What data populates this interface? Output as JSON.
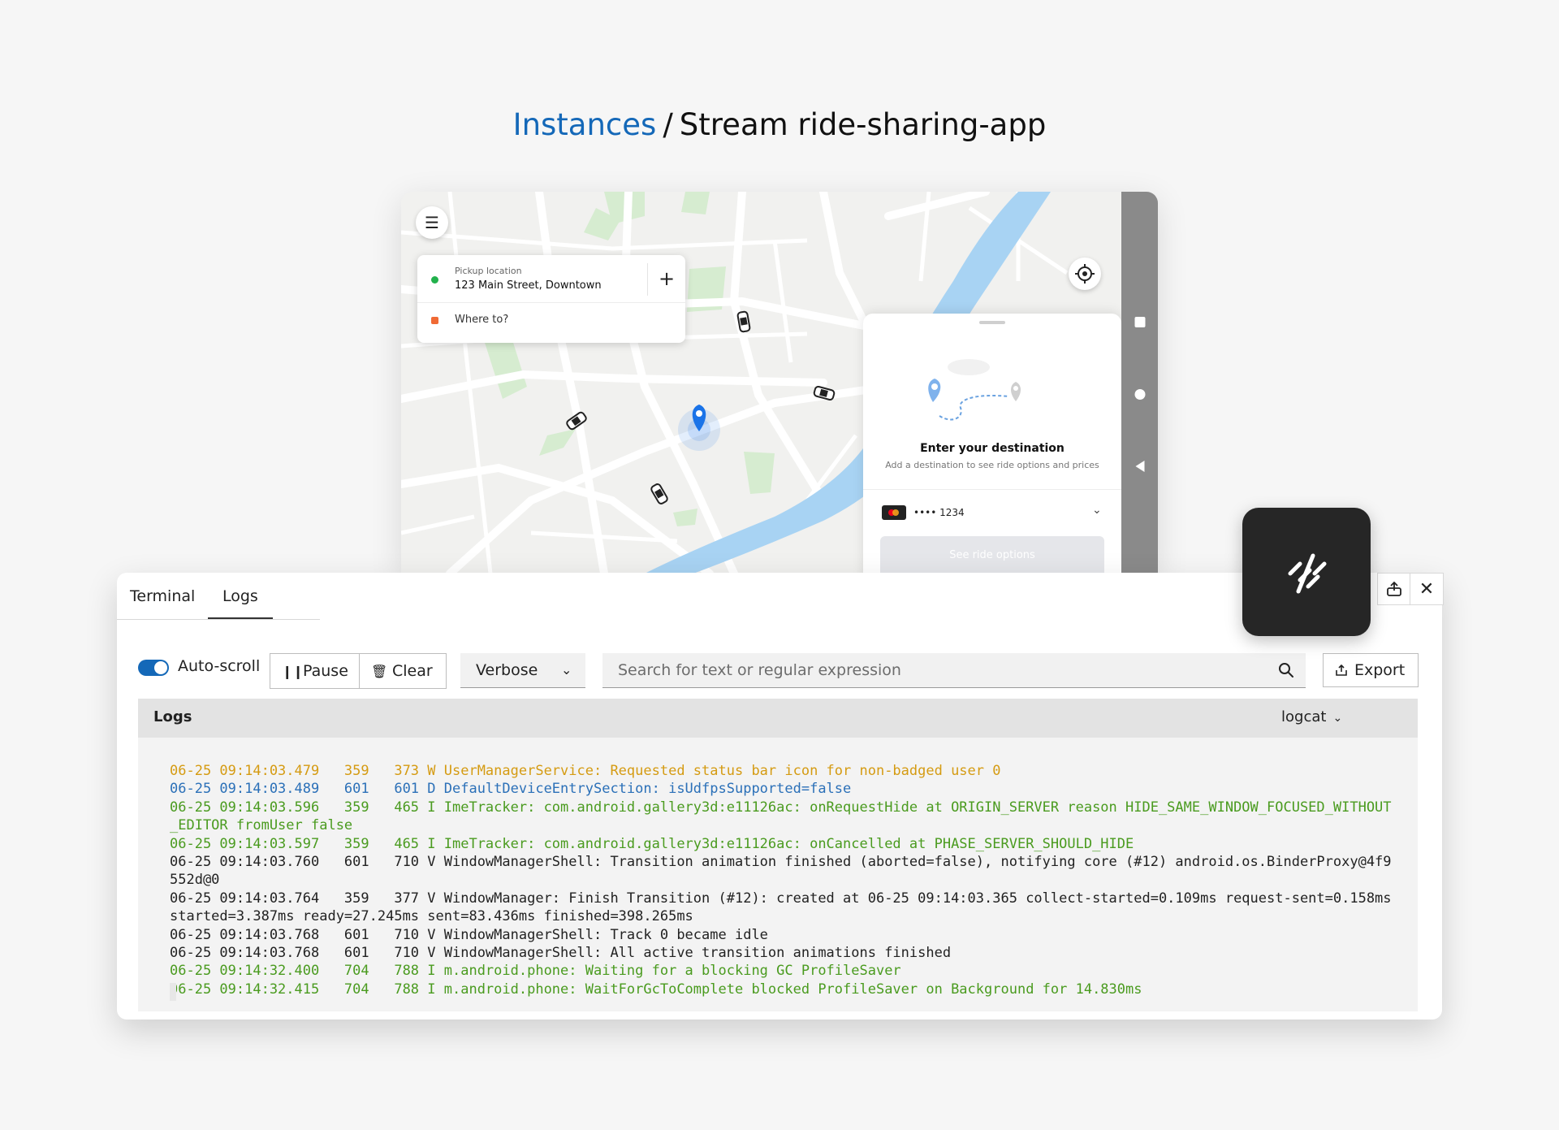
{
  "breadcrumb": {
    "link": "Instances",
    "separator": "/",
    "current": "Stream ride-sharing-app"
  },
  "app": {
    "pickup_label": "Pickup location",
    "pickup_value": "123 Main Street, Downtown",
    "destination_placeholder": "Where to?",
    "sheet_title": "Enter your destination",
    "sheet_subtitle": "Add a destination to see ride options and prices",
    "card_number": "•••• 1234",
    "see_options_label": "See ride options"
  },
  "panel": {
    "tabs": [
      {
        "label": "Terminal"
      },
      {
        "label": "Logs",
        "active": true
      }
    ],
    "autoscroll_label": "Auto-scroll",
    "autoscroll_on": true,
    "pause_label": "Pause",
    "clear_label": "Clear",
    "level_value": "Verbose",
    "search_placeholder": "Search for text or regular expression",
    "export_label": "Export",
    "logs_title": "Logs",
    "log_source": "logcat"
  },
  "colors": {
    "accent": "#1468b8",
    "log_W": "#d59b12",
    "log_D": "#2b70b8",
    "log_I": "#4a9b1f",
    "log_V": "#222222"
  },
  "icons": {
    "menu": "hamburger-icon",
    "add": "plus-icon",
    "locate": "crosshair-icon",
    "chevron": "chevron-down-icon",
    "pause": "pause-icon",
    "clear": "trash-icon",
    "search": "search-icon",
    "export": "share-icon",
    "dock": "dock-icon",
    "close": "close-icon",
    "stream": "stream-slash-icon"
  },
  "logs": [
    {
      "level": "W",
      "text": "06-25 09:14:03.479   359   373 W UserManagerService: Requested status bar icon for non-badged user 0"
    },
    {
      "level": "D",
      "text": "06-25 09:14:03.489   601   601 D DefaultDeviceEntrySection: isUdfpsSupported=false"
    },
    {
      "level": "I",
      "text": "06-25 09:14:03.596   359   465 I ImeTracker: com.android.gallery3d:e11126ac: onRequestHide at ORIGIN_SERVER reason HIDE_SAME_WINDOW_FOCUSED_WITHOUT_EDITOR fromUser false"
    },
    {
      "level": "I",
      "text": "06-25 09:14:03.597   359   465 I ImeTracker: com.android.gallery3d:e11126ac: onCancelled at PHASE_SERVER_SHOULD_HIDE"
    },
    {
      "level": "V",
      "text": "06-25 09:14:03.760   601   710 V WindowManagerShell: Transition animation finished (aborted=false), notifying core (#12) android.os.BinderProxy@4f9552d@0"
    },
    {
      "level": "V",
      "text": "06-25 09:14:03.764   359   377 V WindowManager: Finish Transition (#12): created at 06-25 09:14:03.365 collect-started=0.109ms request-sent=0.158ms started=3.387ms ready=27.245ms sent=83.436ms finished=398.265ms"
    },
    {
      "level": "V",
      "text": "06-25 09:14:03.768   601   710 V WindowManagerShell: Track 0 became idle"
    },
    {
      "level": "V",
      "text": "06-25 09:14:03.768   601   710 V WindowManagerShell: All active transition animations finished"
    },
    {
      "level": "I",
      "text": "06-25 09:14:32.400   704   788 I m.android.phone: Waiting for a blocking GC ProfileSaver"
    },
    {
      "level": "I",
      "text": "06-25 09:14:32.415   704   788 I m.android.phone: WaitForGcToComplete blocked ProfileSaver on Background for 14.830ms"
    }
  ]
}
